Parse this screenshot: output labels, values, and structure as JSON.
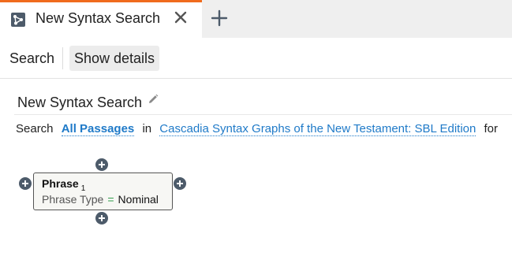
{
  "tab": {
    "title": "New Syntax Search",
    "icon": "syntax-search-icon",
    "accent_color": "#f06b1d"
  },
  "toolbar": {
    "search_label": "Search",
    "details_label": "Show details"
  },
  "page": {
    "title": "New Syntax Search"
  },
  "sentence": {
    "prefix": "Search",
    "scope": "All Passages",
    "in": "in",
    "resource": "Cascadia Syntax Graphs of the New Testament: SBL Edition",
    "suffix": "for"
  },
  "node": {
    "title": "Phrase",
    "index": "1",
    "attr_key": "Phrase Type",
    "attr_op": "=",
    "attr_value": "Nominal"
  },
  "colors": {
    "link": "#1f7ac8",
    "operator": "#2e9b48",
    "plus_button": "#4d5b6a"
  }
}
